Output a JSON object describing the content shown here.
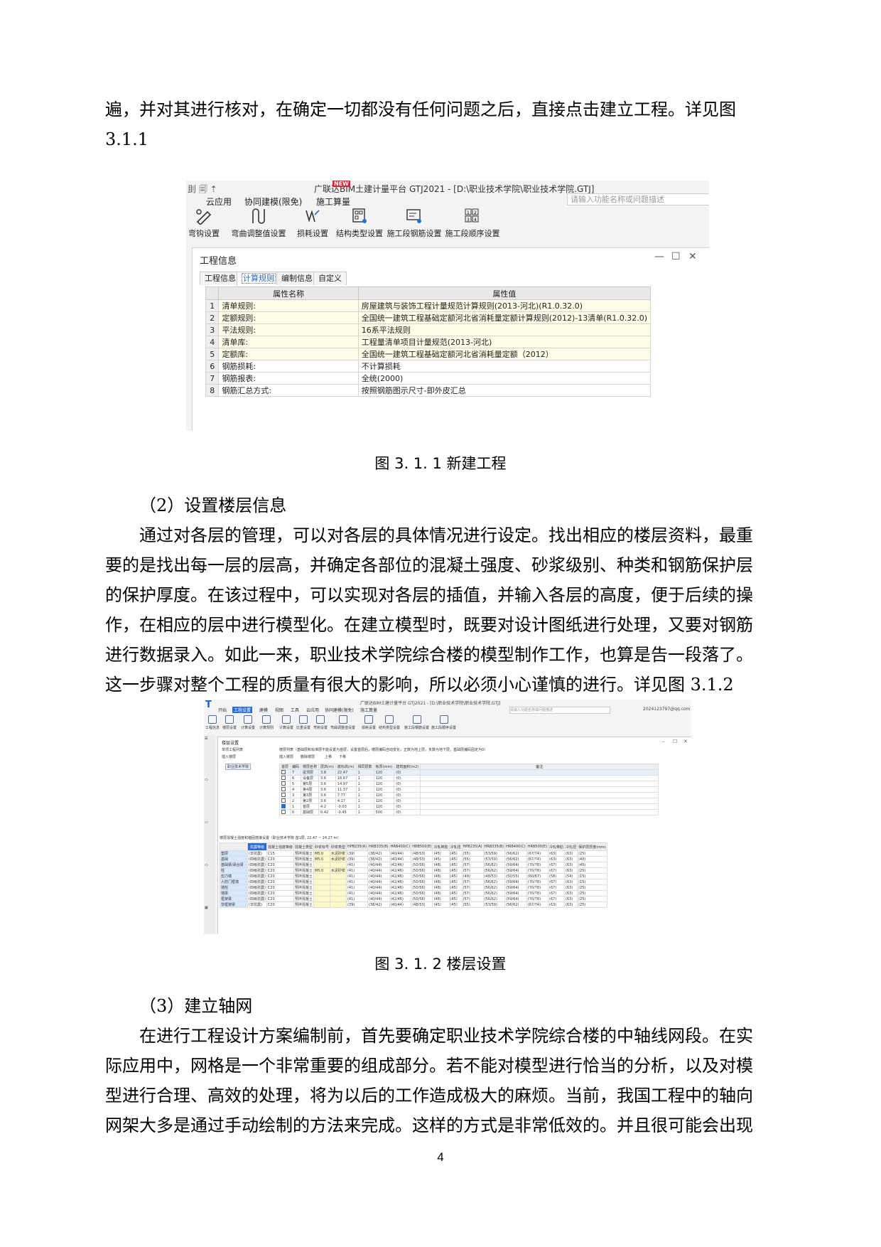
{
  "paragraphs": {
    "p1_line1": "遍，并对其进行核对，在确定一切都没有任何问题之后，直接点击建立工程。详见图",
    "p1_line2": "3.1.1",
    "fig1_caption": "图 3. 1. 1 新建工程",
    "h2": "（2）设置楼层信息",
    "p2_l1": "通过对各层的管理，可以对各层的具体情况进行设定。找出相应的楼层资料，最重",
    "p2_l2": "要的是找出每一层的层高，并确定各部位的混凝土强度、砂浆级别、种类和钢筋保护层",
    "p2_l3": "的保护厚度。在该过程中，可以实现对各层的插值，并输入各层的高度，便于后续的操",
    "p2_l4": "作，在相应的层中进行模型化。在建立模型时，既要对设计图纸进行处理，又要对钢筋",
    "p2_l5": "进行数据录入。如此一来，职业技术学院综合楼的模型制作工作，也算是告一段落了。",
    "p2_l6": "这一步骤对整个工程的质量有很大的影响，所以必须小心谨慎的进行。详见图 3.1.2",
    "fig2_caption": "图 3. 1. 2 楼层设置",
    "h3": "（3）建立轴网",
    "p3_l1": "在进行工程设计方案编制前，首先要确定职业技术学院综合楼的中轴线网段。在实",
    "p3_l2": "际应用中，网格是一个非常重要的组成部分。若不能对模型进行恰当的分析，以及对模",
    "p3_l3": "型进行合理、高效的处理，将为以后的工作造成极大的麻烦。当前，我国工程中的轴向",
    "p3_l4": "网架大多是通过手动绘制的方法来完成。这样的方式是非常低效的。并且很可能会出现",
    "page_number": "4"
  },
  "fig1": {
    "quick_access": "刞 🗐 ⇡",
    "window_title_a": "广联达BIM土建计量平台 GTJ2021 - [D:\\职业技术学院\\职业技术学院.GTJ]",
    "new_badge": "NEW",
    "search_placeholder": "请输入功能名称或问题描述",
    "menu": [
      "云应用",
      "协同建模(限免)",
      "施工算量"
    ],
    "tools": [
      "弯钩设置",
      "弯曲调整值设置",
      "损耗设置",
      "结构类型设置",
      "施工段钢筋设置",
      "施工段顺序设置"
    ],
    "dialog_title": "工程信息",
    "tabs": [
      "工程信息",
      "计算规则",
      "编制信息",
      "自定义"
    ],
    "headers": [
      "属性名称",
      "属性值"
    ],
    "rows": [
      {
        "n": "1",
        "name": "清单规则:",
        "value": "房屋建筑与装饰工程计量规范计算规则(2013-河北)(R1.0.32.0)"
      },
      {
        "n": "2",
        "name": "定额规则:",
        "value": "全国统一建筑工程基础定额河北省消耗量定额计算规则(2012)-13清单(R1.0.32.0)"
      },
      {
        "n": "3",
        "name": "平法规则:",
        "value": "16系平法规则"
      },
      {
        "n": "4",
        "name": "清单库:",
        "value": "工程量清单项目计量规范(2013-河北)"
      },
      {
        "n": "5",
        "name": "定额库:",
        "value": "全国统一建筑工程基础定额河北省消耗量定额（2012）"
      },
      {
        "n": "6",
        "name": "钢筋损耗:",
        "value": "不计算损耗"
      },
      {
        "n": "7",
        "name": "钢筋报表:",
        "value": "全统(2000)"
      },
      {
        "n": "8",
        "name": "钢筋汇总方式:",
        "value": "按照钢筋图示尺寸-即外皮汇总"
      }
    ],
    "controls": [
      "—",
      "☐",
      "✕"
    ]
  },
  "fig2": {
    "logo": "T",
    "title": "广联达BIM土建计量平台 GTJ2021 - [D:\\职业技术学院\\职业技术学院.GTJ]",
    "menu": [
      "开始",
      "工程设置",
      "建模",
      "视图",
      "工具",
      "云应用",
      "协同建模(限免)",
      "施工算量"
    ],
    "search_placeholder": "请输入功能名称或问题描述",
    "user": "2024123797@qq.com",
    "tools": [
      "工程信息",
      "楼层设置",
      "计算设置",
      "计算规则",
      "计算设置",
      "比重设置",
      "弯钩设置",
      "弯曲调整值设置",
      "损耗设置",
      "结构类型设置",
      "施工段钢筋设置",
      "施工段顺序设置"
    ],
    "dialog_title": "楼层设置",
    "left_header": "单项工程列表",
    "project_name": "职业技术学院",
    "floor_hint": "楼层列表（基础层和标准层不能设置为首层，设置首层后，楼层编码自动变化，正数为地上层，负数为地下层，基础层编码固定为0）",
    "btns": [
      "插入楼层",
      "删除楼层",
      "上移",
      "下移"
    ],
    "floor_headers": [
      "首层",
      "编码",
      "楼层名称",
      "层高(m)",
      "底标高(m)",
      "相同层数",
      "板厚(mm)",
      "建筑面积(m2)",
      "备注"
    ],
    "floors": [
      [
        "7",
        "屋顶层",
        "3.8",
        "22.47",
        "1",
        "120",
        "(0)"
      ],
      [
        "6",
        "设备层",
        "3.6",
        "18.67",
        "1",
        "120",
        "(0)"
      ],
      [
        "5",
        "第5层",
        "3.6",
        "14.97",
        "1",
        "120",
        "(0)"
      ],
      [
        "4",
        "第4层",
        "3.6",
        "11.37",
        "1",
        "120",
        "(0)"
      ],
      [
        "3",
        "第3层",
        "3.6",
        "7.77",
        "1",
        "120",
        "(0)"
      ],
      [
        "2",
        "第2层",
        "3.6",
        "4.17",
        "1",
        "120",
        "(0)"
      ],
      [
        "1",
        "首层",
        "4.2",
        "-0.03",
        "1",
        "120",
        "(0)"
      ],
      [
        "0",
        "基础层",
        "0.42",
        "-0.45",
        "1",
        "500",
        "(0)"
      ]
    ],
    "mat_title": "楼层混凝土强度和锚固搭接设置（职业技术学院 首1层, 22.47 ~ 24.27 m）",
    "mat_headers": [
      "抗震等级",
      "混凝土强度等级",
      "混凝土类型",
      "砂浆标号",
      "砂浆类型",
      "HPB235(A)",
      "HRB335(B)",
      "HRB400(C)",
      "HRB500(E)",
      "冷轧带肋",
      "冷轧扭",
      "HPB235(A)",
      "HRB335(B)",
      "HRB400(C)",
      "HRB500(E)",
      "冷轧带肋",
      "冷轧扭",
      "保护层厚度(mm)"
    ],
    "mat_group": [
      "锚固",
      "搭接"
    ],
    "mat_rows": [
      [
        "垫层",
        "(非抗震)",
        "C15",
        "预拌混凝土",
        "M5.0",
        "水泥砂浆",
        "(39)",
        "(38/42)",
        "(40/44)",
        "(48/53)",
        "(45)",
        "(45)",
        "(55)",
        "(53/59)",
        "(56/62)",
        "(67/74)",
        "(63)",
        "(63)",
        "(25)"
      ],
      [
        "基础",
        "(四级抗震)",
        "C20",
        "预拌混凝土",
        "M5.0",
        "水泥砂浆",
        "(39)",
        "(38/42)",
        "(40/44)",
        "(48/53)",
        "(45)",
        "(45)",
        "(55)",
        "(53/59)",
        "(56/62)",
        "(67/74)",
        "(63)",
        "(63)",
        "(40)"
      ],
      [
        "基础梁/承台梁",
        "(四级抗震)",
        "C20",
        "预拌混凝土",
        "",
        "",
        "(41)",
        "(40/44)",
        "(42/46)",
        "(50/56)",
        "(48)",
        "(45)",
        "(57)",
        "(56/62)",
        "(59/64)",
        "(70/78)",
        "(67)",
        "(63)",
        "(40)"
      ],
      [
        "柱",
        "(四级抗震)",
        "C20",
        "预拌混凝土",
        "M5.0",
        "水泥砂浆",
        "(41)",
        "(40/44)",
        "(42/46)",
        "(50/56)",
        "(48)",
        "(45)",
        "(57)",
        "(56/62)",
        "(59/64)",
        "(70/78)",
        "(67)",
        "(63)",
        "(25)"
      ],
      [
        "剪力墙",
        "(四级抗震)",
        "C20",
        "预拌混凝土",
        "",
        "",
        "(41)",
        "(40/44)",
        "(42/46)",
        "(50/56)",
        "(48)",
        "(45)",
        "(49)",
        "(48/53)",
        "(50/55)",
        "(60/67)",
        "(58)",
        "(54)",
        "(15)"
      ],
      [
        "人防门框墙",
        "(四级抗震)",
        "C20",
        "预拌混凝土",
        "",
        "",
        "(41)",
        "(40/44)",
        "(42/46)",
        "(50/56)",
        "(48)",
        "(45)",
        "(57)",
        "(56/62)",
        "(59/64)",
        "(70/78)",
        "(67)",
        "(63)",
        "(15)"
      ],
      [
        "墙柱",
        "(四级抗震)",
        "C20",
        "预拌混凝土",
        "",
        "",
        "(41)",
        "(40/44)",
        "(42/46)",
        "(50/56)",
        "(48)",
        "(45)",
        "(57)",
        "(56/62)",
        "(59/64)",
        "(70/78)",
        "(67)",
        "(63)",
        "(25)"
      ],
      [
        "墙梁",
        "(四级抗震)",
        "C20",
        "预拌混凝土",
        "",
        "",
        "(41)",
        "(40/44)",
        "(42/46)",
        "(50/56)",
        "(48)",
        "(45)",
        "(57)",
        "(56/62)",
        "(59/64)",
        "(70/78)",
        "(67)",
        "(63)",
        "(25)"
      ],
      [
        "框架梁",
        "(四级抗震)",
        "C20",
        "预拌混凝土",
        "",
        "",
        "(41)",
        "(40/44)",
        "(42/46)",
        "(50/56)",
        "(48)",
        "(45)",
        "(57)",
        "(56/62)",
        "(59/64)",
        "(70/78)",
        "(67)",
        "(63)",
        "(25)"
      ],
      [
        "非框架梁",
        "(非抗震)",
        "C20",
        "预拌混凝土",
        "",
        "",
        "(39)",
        "(38/42)",
        "(40/44)",
        "(48/53)",
        "(45)",
        "(45)",
        "(55)",
        "(53/59)",
        "(56/62)",
        "(67/74)",
        "(63)",
        "(63)",
        "(25)"
      ]
    ]
  }
}
